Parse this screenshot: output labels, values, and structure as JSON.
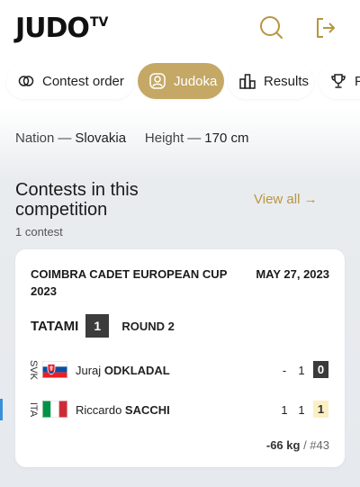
{
  "header": {
    "logo_main": "JUDO",
    "logo_tv": "TV",
    "icons": [
      "search-icon",
      "logout-icon"
    ]
  },
  "tabs": [
    {
      "label": "Contest order",
      "icon": "rings-icon",
      "active": false
    },
    {
      "label": "Judoka",
      "icon": "user-icon",
      "active": true
    },
    {
      "label": "Results",
      "icon": "bar-chart-icon",
      "active": false
    },
    {
      "label": "P",
      "icon": "trophy-icon",
      "active": false
    }
  ],
  "info": {
    "nation_label": "Nation",
    "nation_value": "Slovakia",
    "height_label": "Height",
    "height_value": "170 cm",
    "separator": "—"
  },
  "section": {
    "title": "Contests in this competition",
    "view_all": "View all →",
    "count": "1 contest"
  },
  "contest": {
    "event_name": "COIMBRA CADET EUROPEAN CUP 2023",
    "event_date": "MAY 27, 2023",
    "tatami_label": "TATAMI",
    "tatami_number": "1",
    "round": "ROUND 2",
    "fighters": [
      {
        "country": "SVK",
        "first_name": "Juraj",
        "last_name": "ODKLADAL",
        "score1": "-",
        "score2": "1",
        "score3": "0"
      },
      {
        "country": "ITA",
        "first_name": "Riccardo",
        "last_name": "SACCHI",
        "score1": "1",
        "score2": "1",
        "score3": "1"
      }
    ],
    "weight": "-66 kg",
    "weight_sep": " / ",
    "number": "#43"
  },
  "colors": {
    "accent": "#c5a865",
    "link": "#b8963f",
    "dark_box": "#3a3a3a",
    "winner_box": "#fbefc3",
    "blue_marker": "#3a8fd9"
  }
}
